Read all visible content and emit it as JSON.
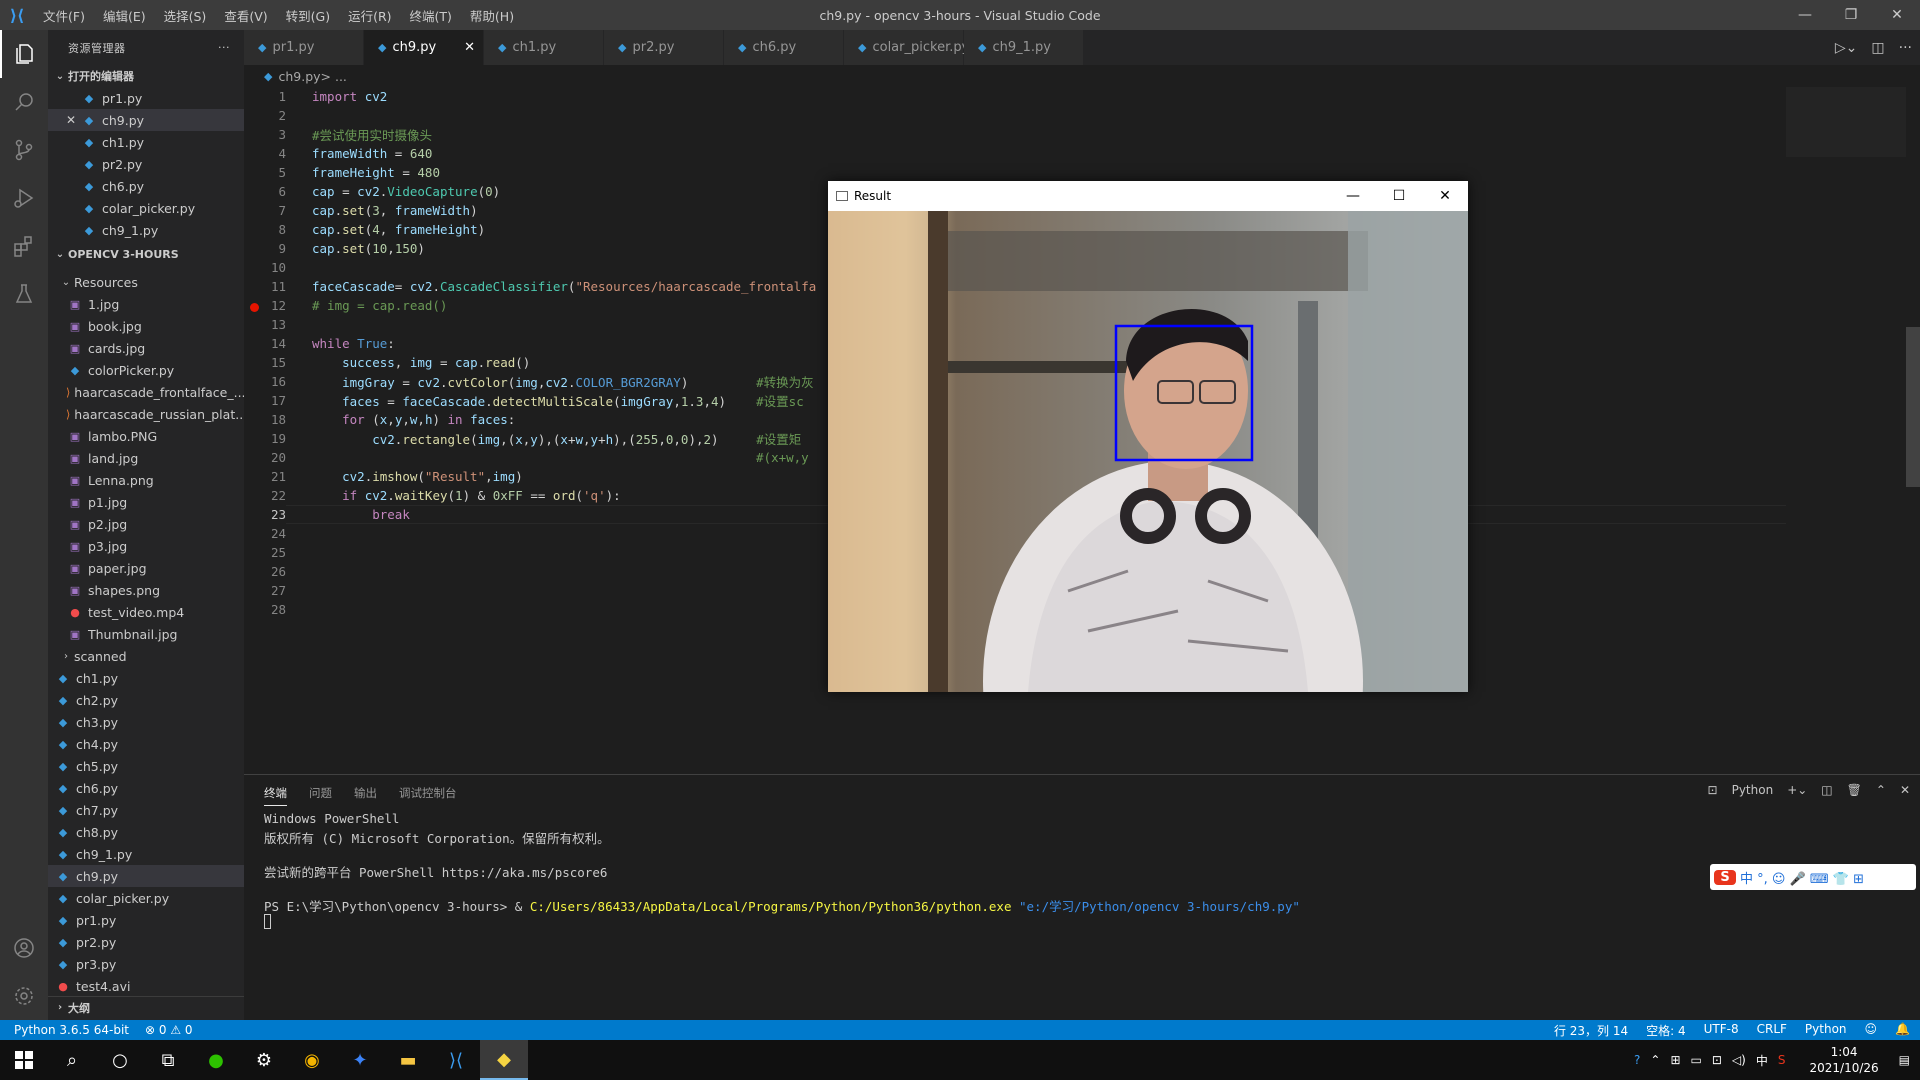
{
  "titlebar": {
    "menu": [
      "文件(F)",
      "编辑(E)",
      "选择(S)",
      "查看(V)",
      "转到(G)",
      "运行(R)",
      "终端(T)",
      "帮助(H)"
    ],
    "title": "ch9.py - opencv 3-hours - Visual Studio Code"
  },
  "sidebar": {
    "header": "资源管理器",
    "open_editors_label": "打开的编辑器",
    "open_editors": [
      "pr1.py",
      "ch9.py",
      "ch1.py",
      "pr2.py",
      "ch6.py",
      "colar_picker.py",
      "ch9_1.py"
    ],
    "project_label": "OPENCV 3-HOURS",
    "resources_label": "Resources",
    "resources": [
      "1.jpg",
      "book.jpg",
      "cards.jpg",
      "colorPicker.py",
      "haarcascade_frontalface_...",
      "haarcascade_russian_plat...",
      "lambo.PNG",
      "land.jpg",
      "Lenna.png",
      "p1.jpg",
      "p2.jpg",
      "p3.jpg",
      "paper.jpg",
      "shapes.png",
      "test_video.mp4",
      "Thumbnail.jpg"
    ],
    "scanned_label": "scanned",
    "root_files": [
      "ch1.py",
      "ch2.py",
      "ch3.py",
      "ch4.py",
      "ch5.py",
      "ch6.py",
      "ch7.py",
      "ch8.py",
      "ch9_1.py",
      "ch9.py",
      "colar_picker.py",
      "pr1.py",
      "pr2.py",
      "pr3.py",
      "test4.avi"
    ],
    "outline_label": "大纲"
  },
  "tabs": [
    "pr1.py",
    "ch9.py",
    "ch1.py",
    "pr2.py",
    "ch6.py",
    "colar_picker.py",
    "ch9_1.py"
  ],
  "active_tab": "ch9.py",
  "breadcrumb": {
    "file": "ch9.py",
    "rest": " > ..."
  },
  "code_lines": [
    "import cv2",
    "",
    "#尝试使用实时摄像头",
    "frameWidth = 640",
    "frameHeight = 480",
    "cap = cv2.VideoCapture(0)",
    "cap.set(3, frameWidth)",
    "cap.set(4, frameHeight)",
    "cap.set(10,150)",
    "",
    "faceCascade= cv2.CascadeClassifier(\"Resources/haarcascade_frontalfa",
    "# img = cap.read()",
    "",
    "while True:",
    "    success, img = cap.read()",
    "    imgGray = cv2.cvtColor(img,cv2.COLOR_BGR2GRAY)         #转换为灰",
    "    faces = faceCascade.detectMultiScale(imgGray,1.3,4)    #设置sc",
    "    for (x,y,w,h) in faces:",
    "        cv2.rectangle(img,(x,y),(x+w,y+h),(255,0,0),2)     #设置矩",
    "                                                           #(x+w,y",
    "    cv2.imshow(\"Result\",img)",
    "    if cv2.waitKey(1) & 0xFF == ord('q'):",
    "        break",
    "",
    "",
    "",
    "",
    ""
  ],
  "current_line": 23,
  "breakpoint_line": 12,
  "result_window": {
    "title": "Result"
  },
  "panel": {
    "tabs": [
      "终端",
      "问题",
      "输出",
      "调试控制台"
    ],
    "shell_label": "Python",
    "terminal": {
      "line1": "Windows PowerShell",
      "line2": "版权所有 (C) Microsoft Corporation。保留所有权利。",
      "line3": "尝试新的跨平台 PowerShell https://aka.ms/pscore6",
      "prompt": "PS E:\\学习\\Python\\opencv 3-hours> & ",
      "exe": "C:/Users/86433/AppData/Local/Programs/Python/Python36/python.exe",
      "script": " \"e:/学习/Python/opencv 3-hours/ch9.py\""
    }
  },
  "ime": {
    "logo": "S",
    "items": "中 °, ☺ 🎤 ⌨ 👕 ⊞"
  },
  "statusbar": {
    "python": "Python 3.6.5 64-bit",
    "problems": "⊗ 0 ⚠ 0",
    "position": "行 23，列 14",
    "spaces": "空格: 4",
    "encoding": "UTF-8",
    "eol": "CRLF",
    "language": "Python"
  },
  "taskbar": {
    "time": "1:04",
    "date": "2021/10/26",
    "ime_char": "中"
  },
  "colors": {
    "accent": "#007acc",
    "face_box": "#0000ff"
  }
}
